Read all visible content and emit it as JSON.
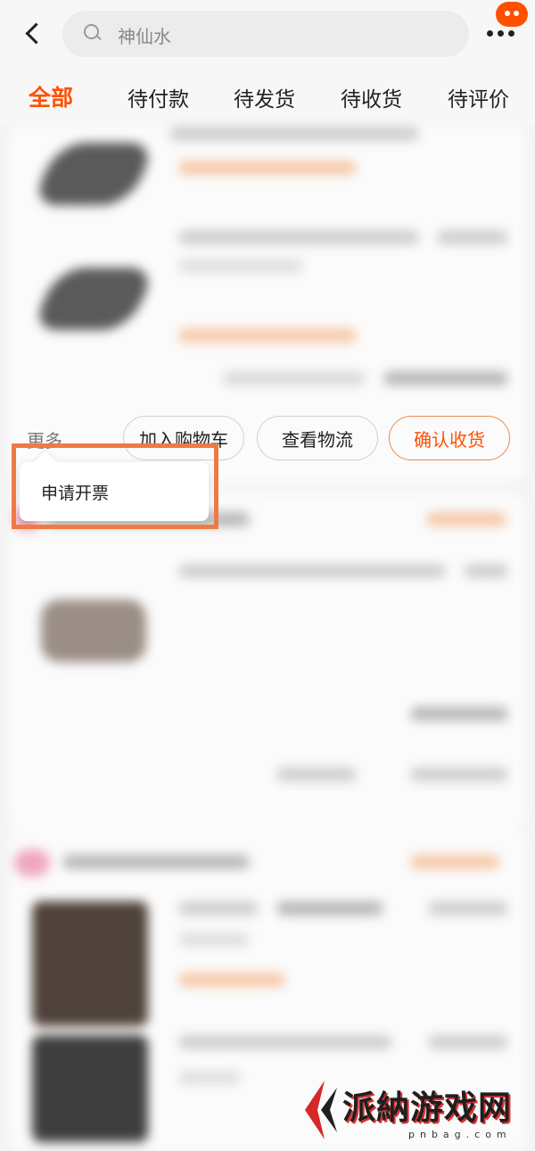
{
  "header": {
    "search_query": "神仙水"
  },
  "tabs": [
    {
      "label": "全部",
      "active": true
    },
    {
      "label": "待付款"
    },
    {
      "label": "待发货"
    },
    {
      "label": "待收货"
    },
    {
      "label": "待评价"
    }
  ],
  "order_actions": {
    "more_label": "更多",
    "add_to_cart": "加入购物车",
    "view_logistics": "查看物流",
    "confirm_receipt": "确认收货"
  },
  "more_menu": {
    "items": [
      "申请开票"
    ]
  },
  "watermark": {
    "text": "派納游戏网",
    "url": "pnbag.com"
  },
  "colors": {
    "accent": "#ff5000",
    "highlight_frame": "#ee7a45"
  }
}
